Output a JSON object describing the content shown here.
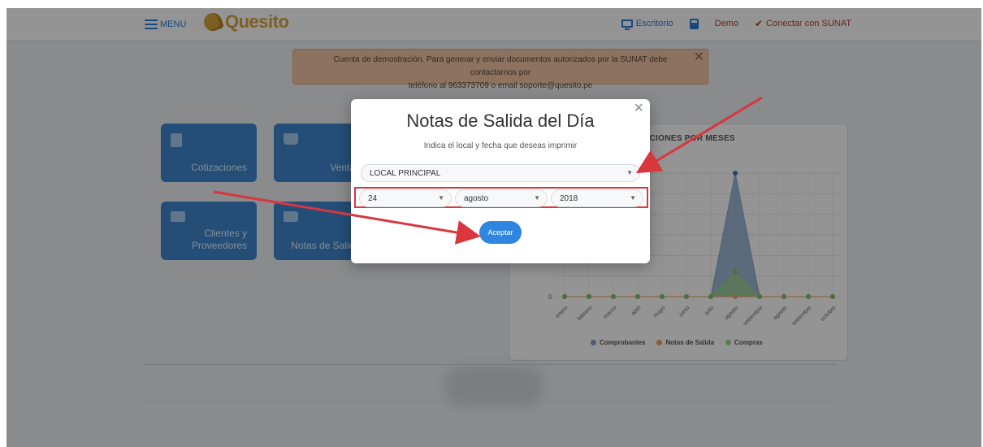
{
  "header": {
    "menu_label": "MENU",
    "logo_text": "Quesito",
    "nav": {
      "escritorio": "Escritorio",
      "demo": "Demo",
      "sunat": "Conectar con SUNAT"
    }
  },
  "alert": {
    "line1": "Cuenta de demostración. Para generar y enviar documentos autorizados por la SUNAT debe contactarnos por",
    "line2": "teléfono al 963373709 o email soporte@quesito.pe"
  },
  "tiles": {
    "cotizaciones": "Cotizaciones",
    "ventas": "Ventas",
    "clientes_line1": "Clientes y",
    "clientes_line2": "Proveedores",
    "notas": "Notas de Salida"
  },
  "chart": {
    "title": "ACIONES POR MESES",
    "legend": [
      "Comprobantes",
      "Notas de Salida",
      "Compras"
    ]
  },
  "chart_data": {
    "type": "area",
    "title": "ACIONES POR MESES",
    "categories": [
      "enero",
      "febrero",
      "marzo",
      "abril",
      "mayo",
      "junio",
      "julio",
      "agosto",
      "setiembre",
      "agosto",
      "setiembre",
      "octubre"
    ],
    "y_tick_labels": [
      "0"
    ],
    "series": [
      {
        "name": "Comprobantes",
        "color": "#7fa2c8",
        "values": [
          0,
          0,
          0,
          0,
          0,
          0,
          0,
          5,
          0,
          0,
          0,
          0
        ]
      },
      {
        "name": "Notas de Salida",
        "color": "#f0a05a",
        "values": [
          0,
          0,
          0,
          0,
          0,
          0,
          0,
          0,
          0,
          0,
          0,
          0
        ]
      },
      {
        "name": "Compras",
        "color": "#9bd48a",
        "values": [
          0,
          0,
          0,
          0,
          0,
          0,
          0,
          1,
          0,
          0,
          0,
          0
        ]
      }
    ],
    "grid": true,
    "legend_position": "bottom"
  },
  "modal": {
    "title": "Notas de Salida del Día",
    "subtitle": "Indica el local y fecha que deseas imprimir",
    "local_value": "LOCAL PRINCIPAL",
    "day_value": "24",
    "month_value": "agosto",
    "year_value": "2018",
    "accept_label": "Aceptar",
    "close_glyph": "×"
  },
  "colors": {
    "primary": "#3f87cf",
    "accent_logo": "#d9a43b",
    "annotation_red": "#d9363e"
  }
}
